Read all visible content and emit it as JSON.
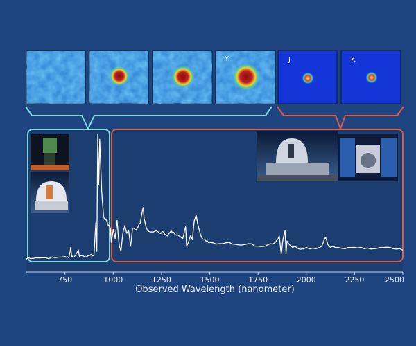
{
  "chart_data": {
    "type": "line",
    "xlabel": "Observed Wavelength (nanometer)",
    "ylabel": "",
    "xlim": [
      550,
      2500
    ],
    "ylim": [
      0,
      100
    ],
    "xticks": [
      "750",
      "1000",
      "1250",
      "1500",
      "1750",
      "2000",
      "2250",
      "2500"
    ],
    "grid": false,
    "series": [
      {
        "values": [
          [
            550,
            2
          ],
          [
            560,
            3
          ],
          [
            600,
            3
          ],
          [
            650,
            3
          ],
          [
            700,
            3
          ],
          [
            750,
            4
          ],
          [
            770,
            3
          ],
          [
            780,
            11
          ],
          [
            785,
            4
          ],
          [
            800,
            4
          ],
          [
            820,
            9
          ],
          [
            825,
            4
          ],
          [
            850,
            4
          ],
          [
            880,
            5
          ],
          [
            900,
            5
          ],
          [
            910,
            30
          ],
          [
            915,
            8
          ],
          [
            920,
            99
          ],
          [
            925,
            60
          ],
          [
            930,
            95
          ],
          [
            940,
            55
          ],
          [
            950,
            35
          ],
          [
            970,
            30
          ],
          [
            985,
            26
          ],
          [
            990,
            15
          ],
          [
            1000,
            25
          ],
          [
            1010,
            18
          ],
          [
            1020,
            32
          ],
          [
            1030,
            14
          ],
          [
            1040,
            8
          ],
          [
            1050,
            22
          ],
          [
            1060,
            28
          ],
          [
            1070,
            22
          ],
          [
            1080,
            24
          ],
          [
            1090,
            12
          ],
          [
            1100,
            26
          ],
          [
            1120,
            25
          ],
          [
            1140,
            30
          ],
          [
            1155,
            42
          ],
          [
            1160,
            33
          ],
          [
            1170,
            27
          ],
          [
            1180,
            24
          ],
          [
            1200,
            23
          ],
          [
            1220,
            24
          ],
          [
            1240,
            22
          ],
          [
            1260,
            23
          ],
          [
            1280,
            20
          ],
          [
            1300,
            24
          ],
          [
            1320,
            21
          ],
          [
            1340,
            20
          ],
          [
            1360,
            18
          ],
          [
            1375,
            27
          ],
          [
            1380,
            12
          ],
          [
            1400,
            20
          ],
          [
            1410,
            17
          ],
          [
            1420,
            32
          ],
          [
            1430,
            36
          ],
          [
            1440,
            28
          ],
          [
            1460,
            18
          ],
          [
            1480,
            16
          ],
          [
            1500,
            15
          ],
          [
            1550,
            14
          ],
          [
            1600,
            15
          ],
          [
            1650,
            13
          ],
          [
            1700,
            14
          ],
          [
            1750,
            12
          ],
          [
            1800,
            13
          ],
          [
            1840,
            15
          ],
          [
            1860,
            20
          ],
          [
            1870,
            6
          ],
          [
            1880,
            18
          ],
          [
            1890,
            24
          ],
          [
            1895,
            6
          ],
          [
            1900,
            16
          ],
          [
            1920,
            12
          ],
          [
            1950,
            11
          ],
          [
            1980,
            10
          ],
          [
            2000,
            11
          ],
          [
            2050,
            10
          ],
          [
            2080,
            12
          ],
          [
            2100,
            19
          ],
          [
            2115,
            12
          ],
          [
            2150,
            11
          ],
          [
            2200,
            10
          ],
          [
            2250,
            11
          ],
          [
            2300,
            10
          ],
          [
            2350,
            10
          ],
          [
            2400,
            11
          ],
          [
            2450,
            10
          ],
          [
            2500,
            9
          ]
        ]
      }
    ]
  },
  "panels": [
    {
      "label": ""
    },
    {
      "label": ""
    },
    {
      "label": ""
    },
    {
      "label": "Y"
    },
    {
      "label": "J"
    },
    {
      "label": "K"
    }
  ],
  "colors": {
    "background": "#1f4580",
    "plot_background": "#1b3d70",
    "spectrum": "#ffffff",
    "optical_bracket": "#7fd9e0",
    "infrared_bracket": "#e05a48",
    "heatmap_field": "#4fa0d8",
    "heatmap_core": "#a01818",
    "ir_field": "#1436d8"
  }
}
